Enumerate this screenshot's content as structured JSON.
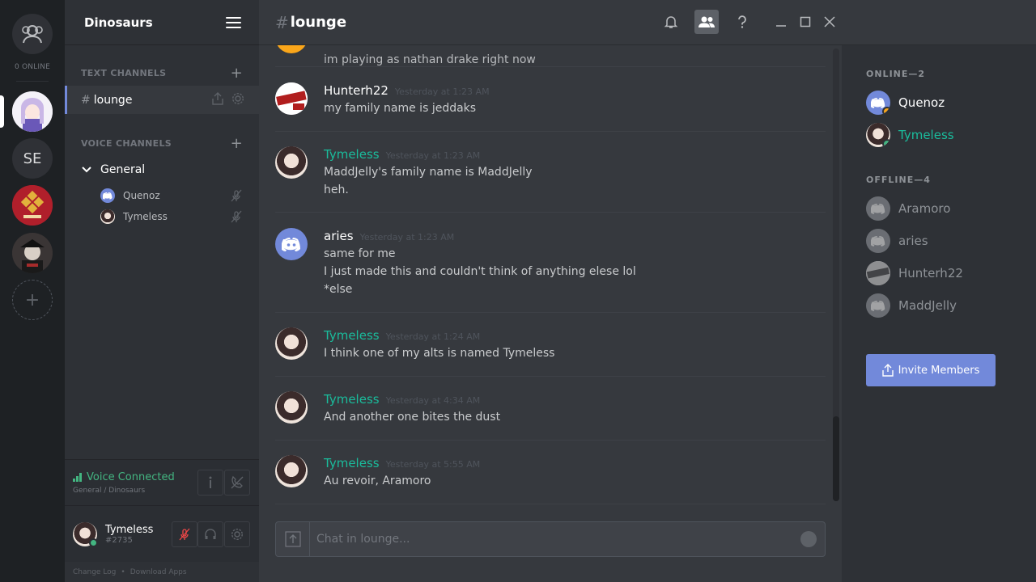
{
  "guilds": {
    "online_label": "0 ONLINE",
    "items": [
      {
        "name": "anime-server",
        "label": ""
      },
      {
        "name": "se-server",
        "label": "SE"
      },
      {
        "name": "crest-server",
        "label": ""
      },
      {
        "name": "dark-server",
        "label": ""
      }
    ],
    "add_label": "+"
  },
  "server": {
    "name": "Dinosaurs",
    "text_category": "TEXT CHANNELS",
    "voice_category": "VOICE CHANNELS",
    "active_channel": "lounge",
    "voice_channel": "General",
    "voice_users": [
      "Quenoz",
      "Tymeless"
    ]
  },
  "voice_status": {
    "label": "Voice Connected",
    "sub": "General / Dinosaurs"
  },
  "user": {
    "name": "Tymeless",
    "tag": "#2735"
  },
  "footer": {
    "changelog": "Change Log",
    "separator": "•",
    "download": "Download Apps"
  },
  "chat": {
    "hash": "#",
    "channel": "lounge",
    "partial_line": "im playing as nathan drake right now",
    "messages": [
      {
        "author": "Hunterh22",
        "timestamp": "Yesterday at 1:23 AM",
        "lines": [
          "my family name is jeddaks"
        ]
      },
      {
        "author": "Tymeless",
        "timestamp": "Yesterday at 1:23 AM",
        "lines": [
          "MaddJelly's family name is MaddJelly",
          "heh."
        ]
      },
      {
        "author": "aries",
        "timestamp": "Yesterday at 1:23 AM",
        "lines": [
          "same for me",
          "I just made this and couldn't think of anything elese lol",
          "*else"
        ]
      },
      {
        "author": "Tymeless",
        "timestamp": "Yesterday at 1:24 AM",
        "lines": [
          "I think one of my alts is named Tymeless"
        ]
      },
      {
        "author": "Tymeless",
        "timestamp": "Yesterday at 4:34 AM",
        "lines": [
          "And another one bites the dust"
        ]
      },
      {
        "author": "Tymeless",
        "timestamp": "Yesterday at 5:55 AM",
        "lines": [
          "Au revoir, Aramoro"
        ]
      }
    ],
    "input_placeholder": "Chat in lounge..."
  },
  "members": {
    "online_header": "ONLINE—2",
    "offline_header": "OFFLINE—4",
    "online": [
      {
        "name": "Quenoz",
        "status_color": "#faa61a"
      },
      {
        "name": "Tymeless",
        "status_color": "#43b581"
      }
    ],
    "offline": [
      "Aramoro",
      "aries",
      "Hunterh22",
      "MaddJelly"
    ],
    "invite_label": "Invite Members"
  },
  "colors": {
    "accent": "#7289da",
    "online": "#43b581",
    "idle": "#faa61a",
    "teal_name": "#1abc9c"
  }
}
